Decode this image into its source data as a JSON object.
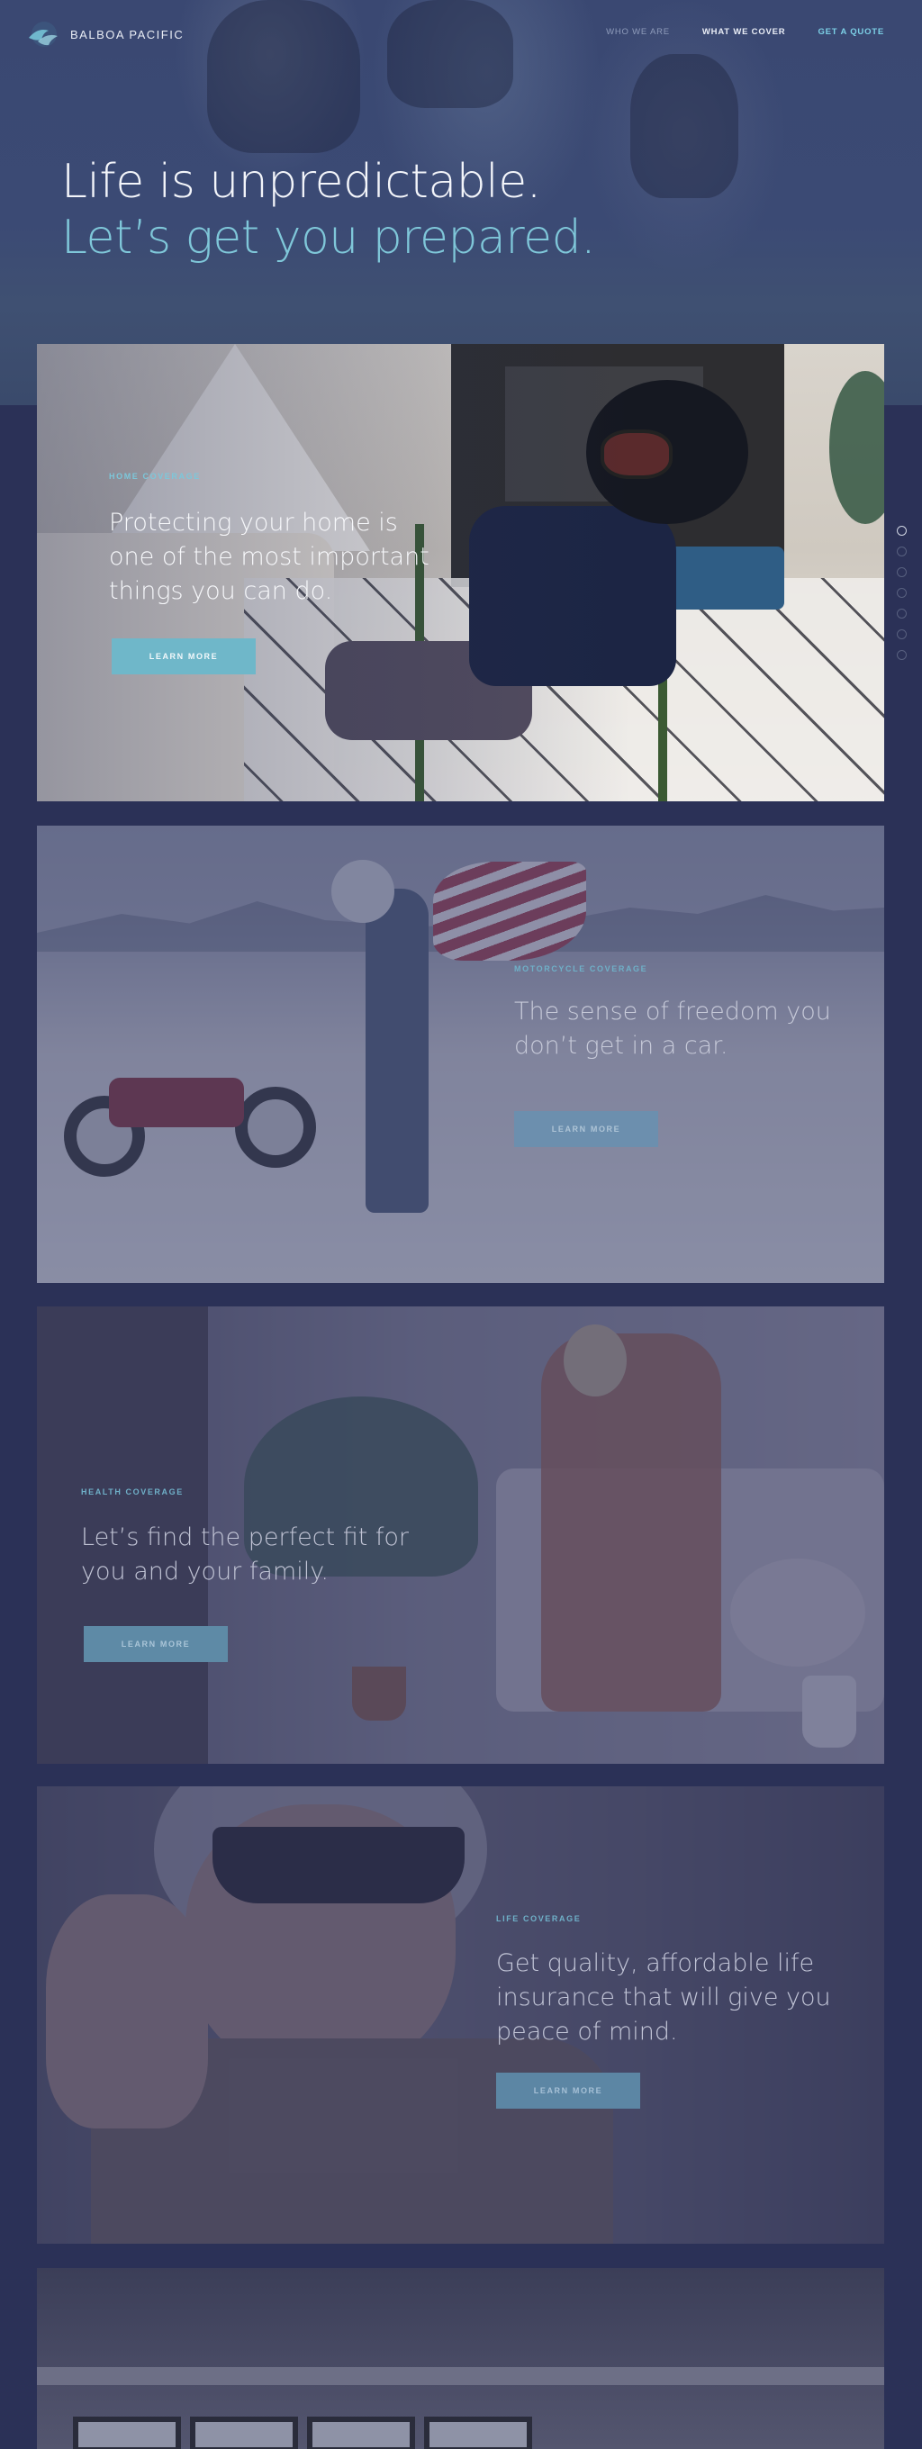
{
  "brand": {
    "name": "BALBOA PACIFIC",
    "accent": "#7cd0e6",
    "background": "#2b3157"
  },
  "nav": {
    "items": [
      {
        "label": "WHO WE ARE"
      },
      {
        "label": "WHAT WE COVER"
      },
      {
        "label": "GET A QUOTE"
      }
    ]
  },
  "hero": {
    "line1": "Life is unpredictable.",
    "line2": "Let’s get you prepared."
  },
  "cards": [
    {
      "eyebrow": "HOME COVERAGE",
      "headline": "Protecting your home is one of the most important things you can do.",
      "button": "LEARN MORE"
    },
    {
      "eyebrow": "MOTORCYCLE COVERAGE",
      "headline": "The sense of freedom you don’t get in a car.",
      "button": "LEARN MORE"
    },
    {
      "eyebrow": "HEALTH COVERAGE",
      "headline": "Let’s find the perfect fit for you and your family.",
      "button": "LEARN MORE"
    },
    {
      "eyebrow": "LIFE COVERAGE",
      "headline": "Get quality, affordable life insurance that will give you peace of mind.",
      "button": "LEARN MORE"
    }
  ],
  "pager": {
    "count": 7,
    "active_index": 0
  }
}
